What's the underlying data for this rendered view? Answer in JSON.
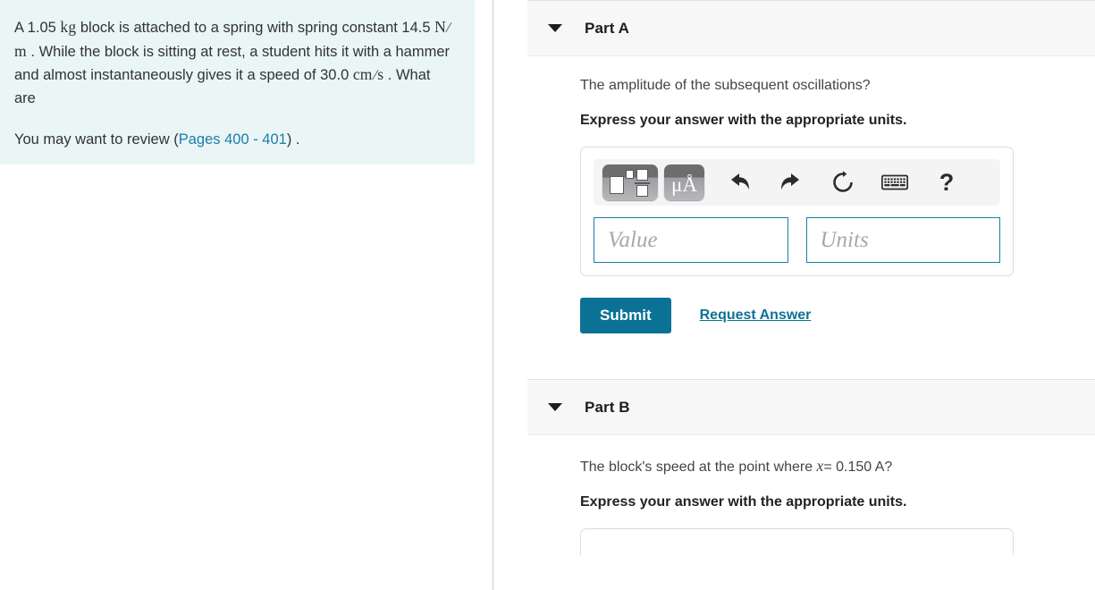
{
  "question": {
    "line1_a": "A 1.05 ",
    "unit_kg": "kg",
    "line1_b": " block is attached to a spring with spring constant 14.5 ",
    "unit_n": "N",
    "slash1": "/",
    "unit_m": "m",
    "line1_c": " . While the block is sitting at rest, a student hits it with a hammer and almost instantaneously gives it a speed of 30.0 ",
    "unit_cm": "cm",
    "slash2": "/",
    "unit_s": "s",
    "line1_d": " . What are",
    "review_prefix": "You may want to review (",
    "review_link": "Pages 400 - 401",
    "review_suffix": ") ."
  },
  "parts": {
    "a": {
      "title": "Part A",
      "prompt": "The amplitude of the subsequent oscillations?",
      "express": "Express your answer with the appropriate units.",
      "value_placeholder": "Value",
      "units_placeholder": "Units",
      "submit_label": "Submit",
      "request_label": "Request Answer",
      "toolbar": {
        "template_button": "math-template",
        "units_button": "μÅ",
        "mu": "μ",
        "angstrom": "Å",
        "undo": "undo",
        "redo": "redo",
        "reset": "reset",
        "keyboard": "keyboard",
        "help": "?"
      }
    },
    "b": {
      "title": "Part B",
      "prompt_before": "The block's speed at the point where ",
      "prompt_var": "x",
      "prompt_after": "= 0.150 A?",
      "express": "Express your answer with the appropriate units."
    }
  },
  "colors": {
    "question_bg": "#e9f6f5",
    "link": "#1a7ea8",
    "accent": "#0b7296",
    "header_bg": "#f7f7f7",
    "divider": "#b8cdd9"
  }
}
